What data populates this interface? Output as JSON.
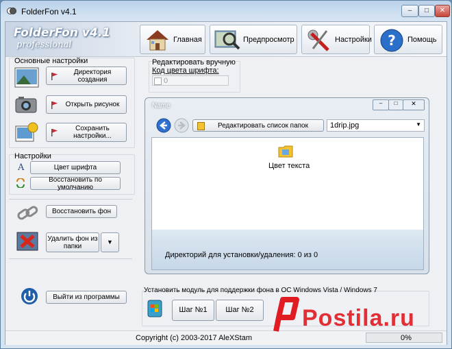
{
  "window": {
    "title": "FolderFon v4.1",
    "controls": [
      "–",
      "□",
      "✕"
    ]
  },
  "header": {
    "logo_main": "FolderFon v4.1",
    "logo_sub": "professional",
    "nav": [
      {
        "label": "Главная",
        "icon": "house-icon"
      },
      {
        "label": "Предпросмотр",
        "icon": "magnifier-icon"
      },
      {
        "label": "Настройки",
        "icon": "tools-icon"
      },
      {
        "label": "Помощь",
        "icon": "help-icon"
      }
    ]
  },
  "main_settings": {
    "heading": "Основные настройки",
    "directory_btn": "Директория создания",
    "open_image_btn": "Открыть рисунок",
    "save_settings_btn": "Сохранить настройки..."
  },
  "settings": {
    "heading": "Настройки",
    "font_color_btn": "Цвет шрифта",
    "restore_defaults_btn": "Восстановить по умолчанию"
  },
  "restore_bg_btn": "Восстановить фон",
  "delete_bg_btn": "Удалить фон из папки",
  "exit_btn": "Выйти из программы",
  "manual_edit": {
    "heading": "Редактировать вручную",
    "font_color_code_label": "Код цвета шрифта:",
    "value": "0"
  },
  "preview": {
    "window_name": "Name",
    "edit_list_btn": "Редактировать список папок",
    "combo_value": "1drip.jpg",
    "folder_label": "Цвет текста",
    "dir_status": "Директорий для установки/удаления: 0 из 0"
  },
  "vista_module": {
    "text": "Установить модуль для  поддержки фона в ОС Windows Vista / Windows 7",
    "step1": "Шаг №1",
    "step2": "Шаг №2"
  },
  "status": {
    "copyright": "Copyright (c) 2003-2017 AleXStam",
    "progress_text": "0%",
    "progress": 0
  },
  "watermark": "Postila.ru",
  "colors": {
    "accent": "#2a6fc9",
    "flag_red": "#d0282e",
    "title_bar": "#b9d1ea"
  }
}
